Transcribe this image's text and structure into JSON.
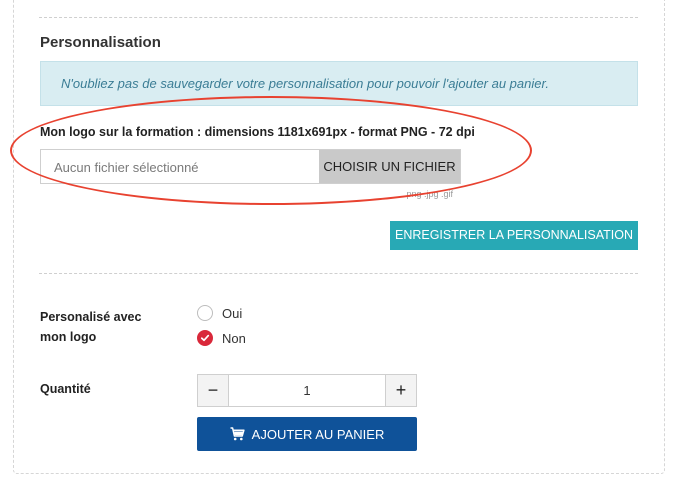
{
  "section": {
    "title": "Personnalisation",
    "alert": "N'oubliez pas de sauvegarder votre personnalisation pour pouvoir l'ajouter au panier."
  },
  "upload": {
    "label": "Mon logo sur la formation : dimensions 1181x691px - format PNG - 72 dpi",
    "placeholder": "Aucun fichier sélectionné",
    "button": "CHOISIR UN FICHIER",
    "hint": ".png .jpg .gif"
  },
  "save_button": "ENREGISTRER LA PERSONNALISATION",
  "option": {
    "label": "Personalisé avec mon logo",
    "choices": [
      {
        "label": "Oui",
        "checked": false
      },
      {
        "label": "Non",
        "checked": true
      }
    ]
  },
  "quantity": {
    "label": "Quantité",
    "value": "1",
    "minus": "−",
    "plus": "+"
  },
  "cart_button": "AJOUTER AU PANIER",
  "icons": {
    "cart": "cart-icon",
    "check": "check-icon"
  },
  "colors": {
    "alert_bg": "#d9edf2",
    "save_button": "#28a9b5",
    "cart_button": "#0f5299",
    "radio_checked": "#d9283a",
    "annotation": "#e84230"
  }
}
